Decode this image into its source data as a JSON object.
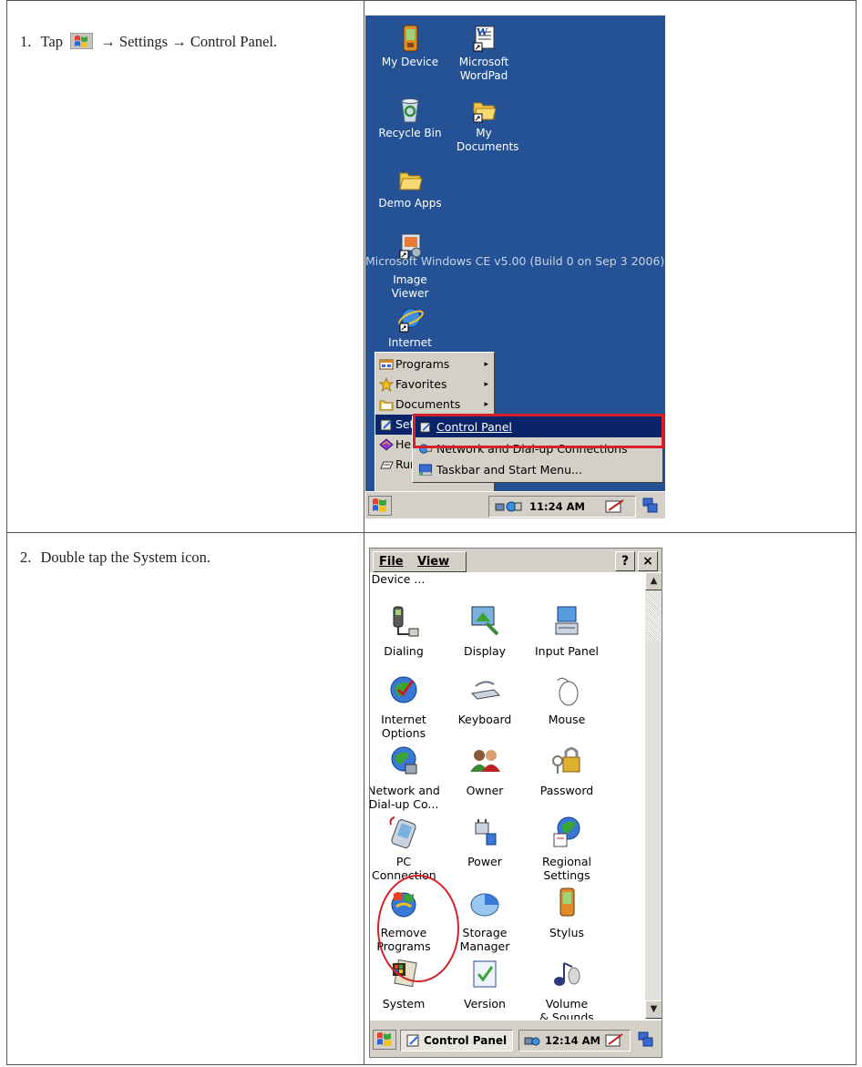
{
  "steps": [
    {
      "number": "1.",
      "before": "Tap",
      "after_icon": "→ Settings → Control Panel."
    },
    {
      "number": "2.",
      "text": "Double tap the System icon."
    }
  ],
  "desktop": {
    "icons": [
      {
        "label": "My Device",
        "icon": "pda-icon"
      },
      {
        "label": "Microsoft WordPad",
        "icon": "wordpad-icon"
      },
      {
        "label": "Recycle Bin",
        "icon": "recycle-bin-icon"
      },
      {
        "label": "My Documents",
        "icon": "folder-icon"
      },
      {
        "label": "Demo Apps",
        "icon": "folder-icon"
      },
      {
        "label": "Image Viewer",
        "icon": "image-viewer-icon"
      },
      {
        "label": "Internet",
        "icon": "internet-explorer-icon"
      }
    ],
    "watermark": "Microsoft Windows CE v5.00 (Build 0 on Sep  3 2006)",
    "start_menu": [
      {
        "label": "Programs",
        "icon": "programs-icon",
        "arrow": "▸"
      },
      {
        "label": "Favorites",
        "icon": "star-icon",
        "arrow": "▸"
      },
      {
        "label": "Documents",
        "icon": "documents-icon",
        "arrow": "▸"
      },
      {
        "label": "Settings",
        "icon": "settings-icon"
      },
      {
        "label": "Help",
        "icon": "help-icon"
      },
      {
        "label": "Run",
        "icon": "run-icon"
      }
    ],
    "settings_menu": [
      {
        "label": "Control Panel",
        "icon": "control-panel-icon"
      },
      {
        "label": "Network and Dial-up Connections",
        "icon": "network-icon"
      },
      {
        "label": "Taskbar and Start Menu...",
        "icon": "taskbar-icon"
      }
    ],
    "clock": "11:24 AM"
  },
  "control_panel": {
    "menu": {
      "file": "File",
      "view": "View"
    },
    "help_button": "?",
    "close_button": "×",
    "partial_row": [
      "Device ..."
    ],
    "items": [
      {
        "label": "Dialing",
        "icon": "dialing-icon"
      },
      {
        "label": "Display",
        "icon": "display-icon"
      },
      {
        "label": "Input Panel",
        "icon": "input-panel-icon"
      },
      {
        "label": "Internet Options",
        "icon": "internet-options-icon"
      },
      {
        "label": "Keyboard",
        "icon": "keyboard-icon"
      },
      {
        "label": "Mouse",
        "icon": "mouse-icon"
      },
      {
        "label": "Network and Dial-up Co...",
        "icon": "network-globe-icon"
      },
      {
        "label": "Owner",
        "icon": "owner-icon"
      },
      {
        "label": "Password",
        "icon": "password-icon"
      },
      {
        "label": "PC Connection",
        "icon": "pc-connection-icon"
      },
      {
        "label": "Power",
        "icon": "power-icon"
      },
      {
        "label": "Regional Settings",
        "icon": "regional-settings-icon"
      },
      {
        "label": "Remove Programs",
        "icon": "remove-programs-icon"
      },
      {
        "label": "Storage Manager",
        "icon": "storage-manager-icon"
      },
      {
        "label": "Stylus",
        "icon": "stylus-icon"
      },
      {
        "label": "System",
        "icon": "system-icon"
      },
      {
        "label": "Version",
        "icon": "version-icon"
      },
      {
        "label": "Volume & Sounds",
        "icon": "volume-icon"
      }
    ],
    "taskbar_button": "Control Panel",
    "clock": "12:14 AM"
  },
  "colors": {
    "desktop_bg": "#245294",
    "highlight": "#0a246a",
    "callout": "#d6202a",
    "chrome": "#d4d0c8"
  }
}
